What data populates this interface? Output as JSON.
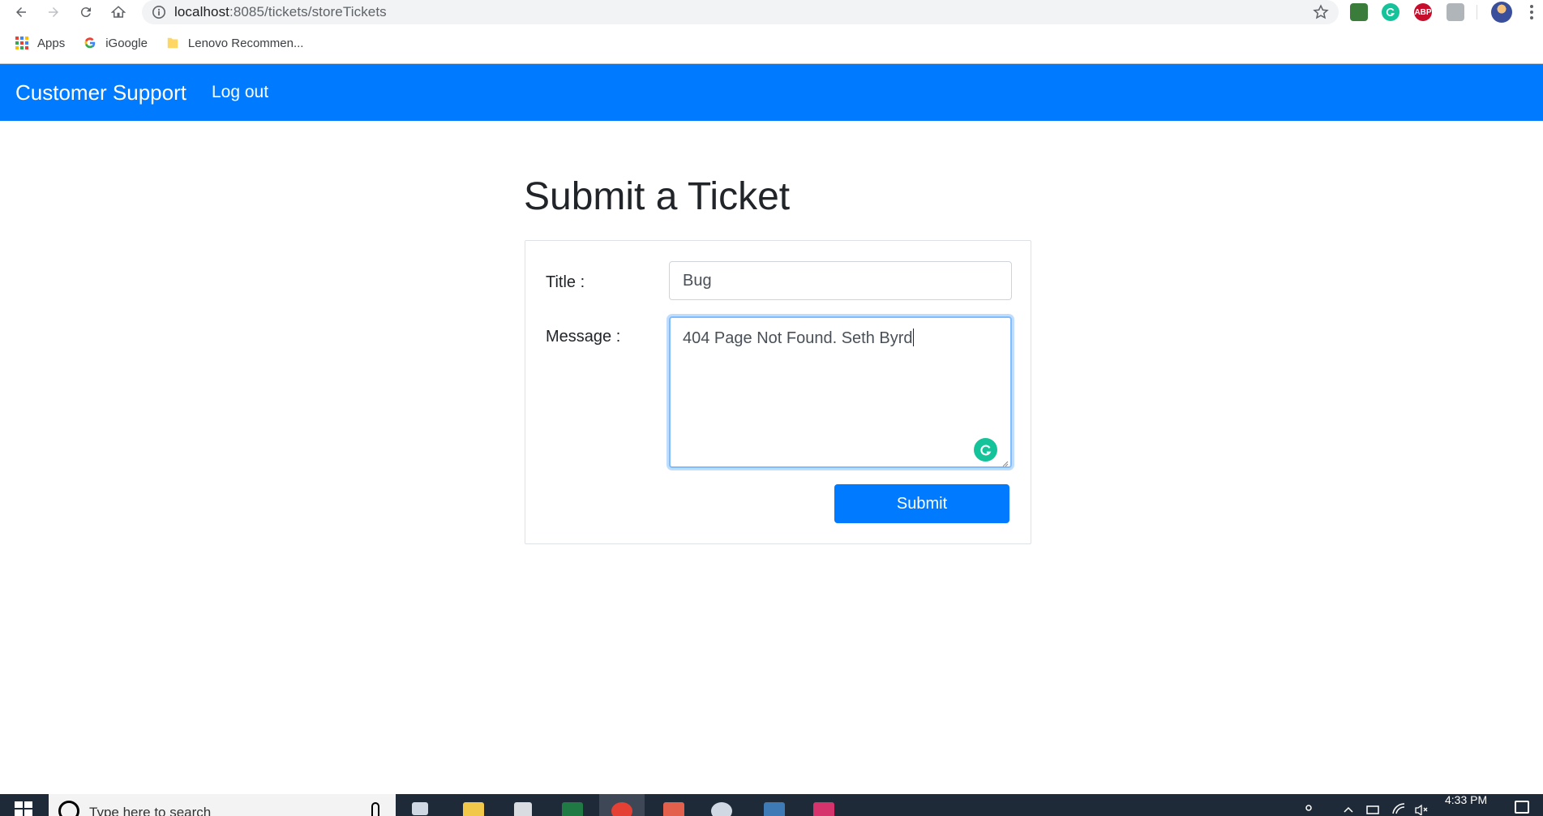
{
  "browser": {
    "url_host": "localhost",
    "url_path": ":8085/tickets/storeTickets",
    "bookmarks": [
      {
        "label": "Apps",
        "icon": "apps-grid-icon"
      },
      {
        "label": "iGoogle",
        "icon": "google-icon"
      },
      {
        "label": "Lenovo Recommen...",
        "icon": "folder-icon"
      }
    ],
    "extensions": [
      {
        "name": "extension-green-icon",
        "color": "#3a7d3a"
      },
      {
        "name": "grammarly-extension-icon",
        "color": "#15c39a"
      },
      {
        "name": "adblock-plus-icon",
        "color": "#c70d2c",
        "text": "ABP"
      },
      {
        "name": "extension-gray-icon",
        "color": "#b0b5ba"
      }
    ]
  },
  "navbar": {
    "brand": "Customer Support",
    "logout": "Log out",
    "color": "#007bff"
  },
  "form": {
    "heading": "Submit a Ticket",
    "title_label": "Title :",
    "title_value": "Bug",
    "message_label": "Message :",
    "message_value": "404 Page Not Found. Seth Byrd",
    "submit_label": "Submit"
  },
  "taskbar": {
    "search_placeholder": "Type here to search",
    "clock_time": "4:33 PM",
    "apps": [
      {
        "name": "task-view-icon",
        "color": "#cfd8e3",
        "active": false
      },
      {
        "name": "file-explorer-icon",
        "color": "#f2c84b",
        "active": false
      },
      {
        "name": "app-icon",
        "color": "#d9dde2",
        "active": false
      },
      {
        "name": "excel-icon",
        "color": "#1f7a44",
        "active": false
      },
      {
        "name": "chrome-icon",
        "color": "#e44134",
        "active": true
      },
      {
        "name": "paint-icon",
        "color": "#e2604c",
        "active": false
      },
      {
        "name": "settings-gear-icon",
        "color": "#cfd8e3",
        "active": false
      },
      {
        "name": "mysql-workbench-icon",
        "color": "#3e7bb6",
        "active": false
      },
      {
        "name": "intellij-idea-icon",
        "color": "#d6336c",
        "active": false
      }
    ]
  }
}
